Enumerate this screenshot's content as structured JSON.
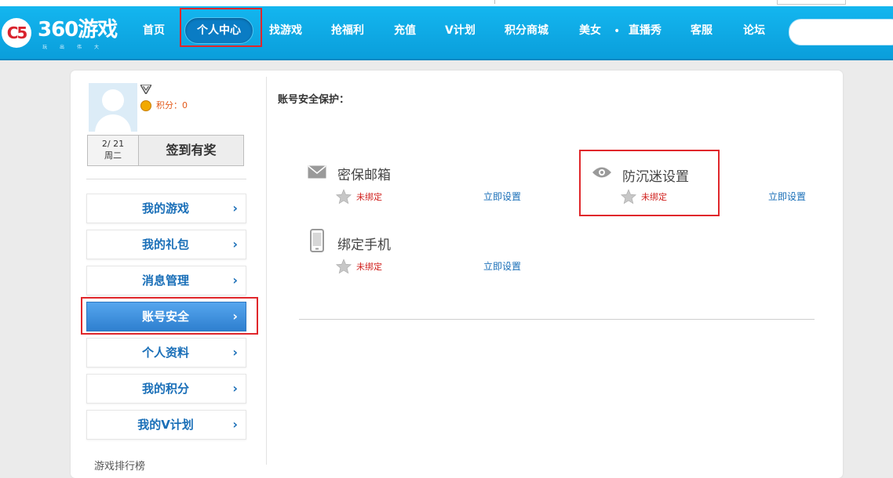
{
  "nav": {
    "logo_text": "360游戏",
    "logo_sub": "玩出伟大",
    "logo_mark": "C5",
    "items": [
      "首页",
      "个人中心",
      "找游戏",
      "抢福利",
      "充值",
      "V计划",
      "积分商城",
      "美女",
      "直播秀",
      "客服",
      "论坛"
    ],
    "dot": "•",
    "search_placeholder": ""
  },
  "profile": {
    "points_label": "积分：0",
    "sign_date": "2/ 21",
    "sign_weekday": "周二",
    "sign_button": "签到有奖"
  },
  "menu": [
    {
      "label": "我的游戏",
      "active": false
    },
    {
      "label": "我的礼包",
      "active": false
    },
    {
      "label": "消息管理",
      "active": false
    },
    {
      "label": "账号安全",
      "active": true
    },
    {
      "label": "个人资料",
      "active": false
    },
    {
      "label": "我的积分",
      "active": false
    },
    {
      "label": "我的V计划",
      "active": false
    }
  ],
  "menu_arrow": "›",
  "menu_partial": "游戏排行榜",
  "security": {
    "title": "账号安全保护：",
    "items": [
      {
        "name": "密保邮箱",
        "icon": "mail-icon",
        "status": "未绑定",
        "action": "立即设置"
      },
      {
        "name": "防沉迷设置",
        "icon": "eye-icon",
        "status": "未绑定",
        "action": "立即设置"
      },
      {
        "name": "绑定手机",
        "icon": "phone-icon",
        "status": "未绑定",
        "action": "立即设置"
      }
    ]
  },
  "colors": {
    "nav": "#0a9edb",
    "link": "#1a6fb8",
    "alert": "#d0201d",
    "highlight": "#e0272b"
  }
}
